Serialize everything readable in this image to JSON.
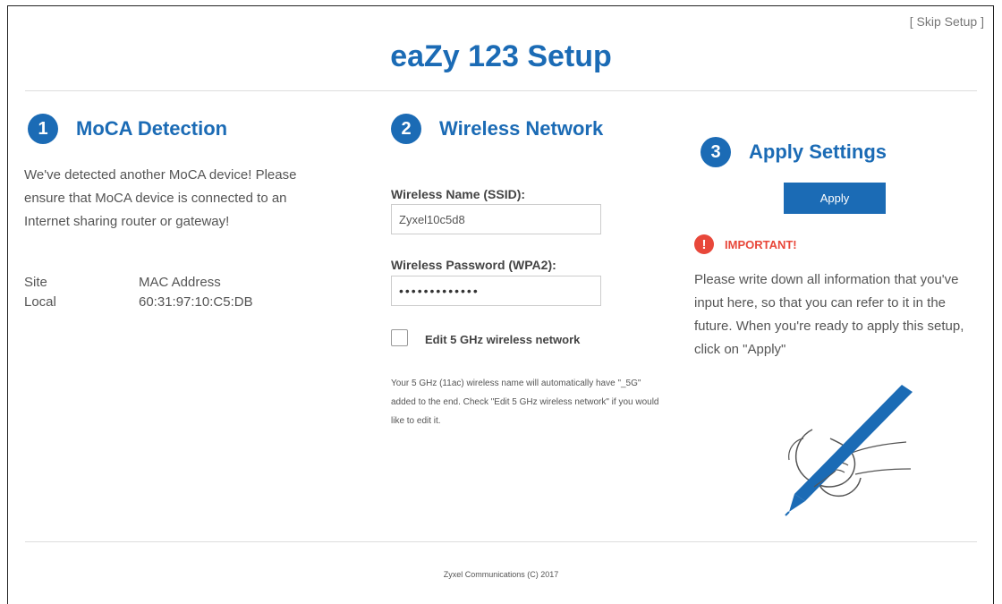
{
  "header": {
    "skip_link": "[ Skip Setup ]",
    "title": "eaZy 123 Setup"
  },
  "steps": [
    {
      "number": "1",
      "title": "MoCA Detection",
      "message": "We've detected another MoCA device! Please ensure that MoCA device is connected to an Internet sharing router or gateway!",
      "table": {
        "headers": [
          "Site",
          "MAC Address"
        ],
        "rows": [
          [
            "Local",
            "60:31:97:10:C5:DB"
          ]
        ]
      }
    },
    {
      "number": "2",
      "title": "Wireless Network",
      "ssid_label": "Wireless Name (SSID):",
      "ssid_value": "Zyxel10c5d8",
      "password_label": "Wireless Password (WPA2):",
      "password_value": "•••••••••••••",
      "checkbox_label": "Edit 5 GHz wireless network",
      "checkbox_checked": false,
      "note": "Your 5 GHz (11ac) wireless name will automatically have \"_5G\" added to the end. Check \"Edit 5 GHz wireless network\" if you would like to edit it."
    },
    {
      "number": "3",
      "title": "Apply Settings",
      "apply_label": "Apply",
      "important_label": "IMPORTANT!",
      "important_icon": "exclamation-icon",
      "message": "Please write down all information that you've input here, so that you can refer to it in the future. When you're ready to apply this setup, click on \"Apply\""
    }
  ],
  "footer": {
    "copyright": "Zyxel Communications (C) 2017"
  },
  "colors": {
    "brand_blue": "#1b6bb5",
    "warning_red": "#e8473a"
  }
}
